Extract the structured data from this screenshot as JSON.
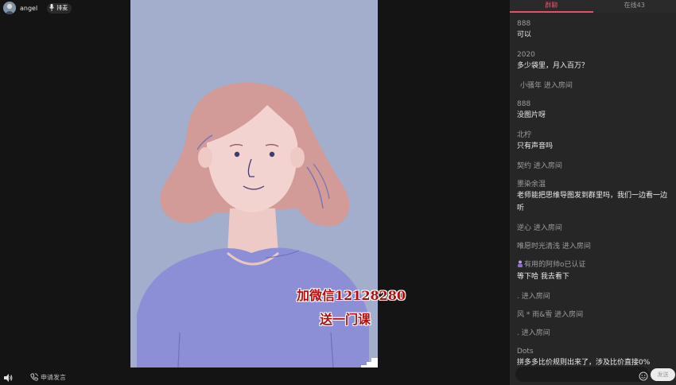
{
  "host": {
    "name": "angel"
  },
  "rank": {
    "label": "排麦"
  },
  "bottom": {
    "apply_label": "申请发言"
  },
  "watermark": {
    "line1": "加微信12128280",
    "line2": "送一门课"
  },
  "tabs": [
    {
      "label": "群聊",
      "active": true
    },
    {
      "label": "在线43",
      "active": false
    }
  ],
  "chat": {
    "m1": {
      "user": "888",
      "text": "可以"
    },
    "m2": {
      "user": "2020",
      "text": "多少袋里，月入百万？"
    },
    "e1": "小骚年 进入房间",
    "m3": {
      "user": "888",
      "text": "没图片呀"
    },
    "m4": {
      "user": "北柠",
      "text": "只有声音吗"
    },
    "e2": "契约 进入房间",
    "m5": {
      "user": "墨染余温",
      "text": "老师能把思维导图发到群里吗，我们一边看一边听"
    },
    "e3": "逆心 进入房间",
    "e4": "唯愿时光清浅 进入房间",
    "m6": {
      "user": "有用的阿帅o已认证",
      "text": "等下哈 我去看下"
    },
    "e5": ". 进入房间",
    "e6": "风 * 雨&雪 进入房间",
    "e7": ". 进入房间",
    "m7": {
      "user": "Dots",
      "text": "拼多多比价规则出来了，涉及比价直接0%"
    }
  },
  "input": {
    "placeholder": "",
    "send_label": "发送"
  },
  "colors": {
    "accent": "#e8506a",
    "panel": "#262626",
    "video_bg": "#a2aecb",
    "watermark": "#b40f0f"
  },
  "icons": [
    "avatar",
    "mic-icon",
    "volume-icon",
    "phone-icon",
    "verified-user-icon",
    "emoji-icon"
  ]
}
